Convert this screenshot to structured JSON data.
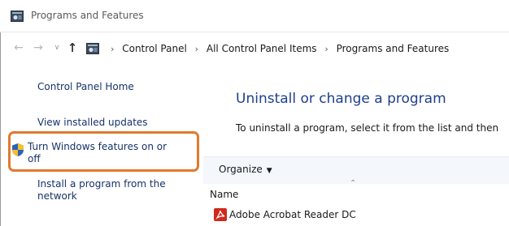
{
  "window": {
    "title": "Programs and Features",
    "icon": "control-panel-icon"
  },
  "navigation": {
    "back_icon": "arrow-left-icon",
    "forward_icon": "arrow-right-icon",
    "recent_icon": "chevron-down-icon",
    "up_icon": "arrow-up-icon",
    "breadcrumbs": [
      "Control Panel",
      "All Control Panel Items",
      "Programs and Features"
    ]
  },
  "sidebar": {
    "home": "Control Panel Home",
    "updates": "View installed updates",
    "features_line1": "Turn Windows features on or",
    "features_line2": "off",
    "install_line1": "Install a program from the",
    "install_line2": "network",
    "highlight_color": "#e07a2f"
  },
  "main": {
    "heading": "Uninstall or change a program",
    "description": "To uninstall a program, select it from the list and then",
    "organize_label": "Organize",
    "column_name": "Name",
    "programs": [
      "Adobe Acrobat Reader DC"
    ]
  }
}
